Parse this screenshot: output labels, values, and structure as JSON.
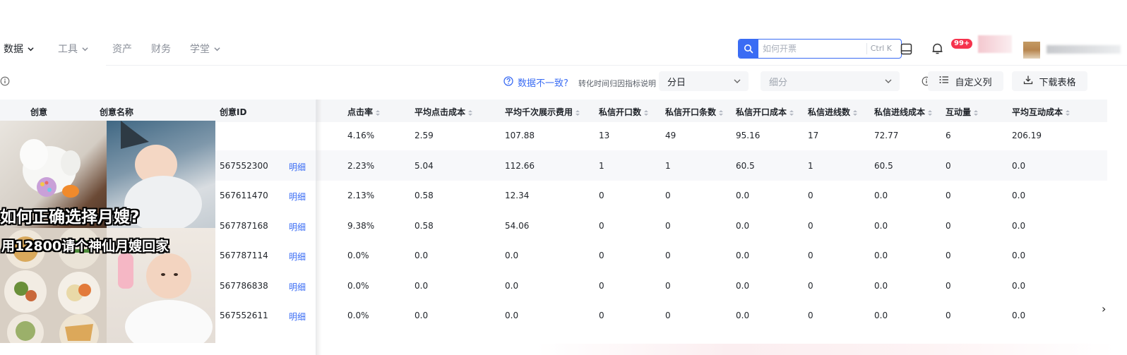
{
  "nav": {
    "items": [
      {
        "label": "数据",
        "has_dropdown": true,
        "active": true
      },
      {
        "label": "工具",
        "has_dropdown": true,
        "active": false
      },
      {
        "label": "资产",
        "has_dropdown": false,
        "active": false
      },
      {
        "label": "财务",
        "has_dropdown": false,
        "active": false
      },
      {
        "label": "学堂",
        "has_dropdown": true,
        "active": false
      }
    ],
    "search_placeholder": "如何开票",
    "search_shortcut": "Ctrl K",
    "notification_badge": "99+"
  },
  "filters": {
    "data_warning": "数据不一致?",
    "data_warning_sub": "转化时间归因指标说明",
    "granularity_value": "分日",
    "breakdown_placeholder": "细分",
    "custom_columns_label": "自定义列",
    "download_label": "下载表格"
  },
  "table": {
    "headers": {
      "creative": "创意",
      "creative_name": "创意名称",
      "creative_id": "创意ID",
      "ctr": "点击率",
      "avg_click_cost": "平均点击成本",
      "cpm": "平均千次展示费用",
      "dm_open": "私信开口数",
      "dm_open_msgs": "私信开口条数",
      "dm_open_cost": "私信开口成本",
      "dm_leads": "私信进线数",
      "dm_lead_cost": "私信进线成本",
      "interactions": "互动量",
      "avg_interaction_cost": "平均互动成本"
    },
    "detail_label": "明细",
    "rows": [
      {
        "id": "",
        "detail": "",
        "ctr": "4.16%",
        "acc": "2.59",
        "cpm": "107.88",
        "dmo": "13",
        "dmm": "49",
        "dmc": "95.16",
        "dml": "17",
        "dlc": "72.77",
        "int": "6",
        "aic": "206.19"
      },
      {
        "id": "567552300",
        "detail": "明细",
        "ctr": "2.23%",
        "acc": "5.04",
        "cpm": "112.66",
        "dmo": "1",
        "dmm": "1",
        "dmc": "60.5",
        "dml": "1",
        "dlc": "60.5",
        "int": "0",
        "aic": "0.0"
      },
      {
        "id": "567611470",
        "detail": "明细",
        "ctr": "2.13%",
        "acc": "0.58",
        "cpm": "12.34",
        "dmo": "0",
        "dmm": "0",
        "dmc": "0.0",
        "dml": "0",
        "dlc": "0.0",
        "int": "0",
        "aic": "0.0"
      },
      {
        "id": "567787168",
        "detail": "明细",
        "ctr": "9.38%",
        "acc": "0.58",
        "cpm": "54.06",
        "dmo": "0",
        "dmm": "0",
        "dmc": "0.0",
        "dml": "0",
        "dlc": "0.0",
        "int": "0",
        "aic": "0.0"
      },
      {
        "id": "567787114",
        "detail": "明细",
        "ctr": "0.0%",
        "acc": "0.0",
        "cpm": "0.0",
        "dmo": "0",
        "dmm": "0",
        "dmc": "0.0",
        "dml": "0",
        "dlc": "0.0",
        "int": "0",
        "aic": "0.0"
      },
      {
        "id": "567786838",
        "detail": "明细",
        "ctr": "0.0%",
        "acc": "0.0",
        "cpm": "0.0",
        "dmo": "0",
        "dmm": "0",
        "dmc": "0.0",
        "dml": "0",
        "dlc": "0.0",
        "int": "0",
        "aic": "0.0"
      },
      {
        "id": "567552611",
        "detail": "明细",
        "ctr": "0.0%",
        "acc": "0.0",
        "cpm": "0.0",
        "dmo": "0",
        "dmm": "0",
        "dmc": "0.0",
        "dml": "0",
        "dlc": "0.0",
        "int": "0",
        "aic": "0.0"
      }
    ]
  },
  "creative_image": {
    "caption_1": "如何正确选择月嫂?",
    "caption_2": "用12800请个神仙月嫂回家"
  },
  "colors": {
    "accent": "#3a6cf4",
    "badge": "#f5334d",
    "header_bg": "#f5f6f8",
    "row_alt_bg": "#f7f8fa"
  }
}
